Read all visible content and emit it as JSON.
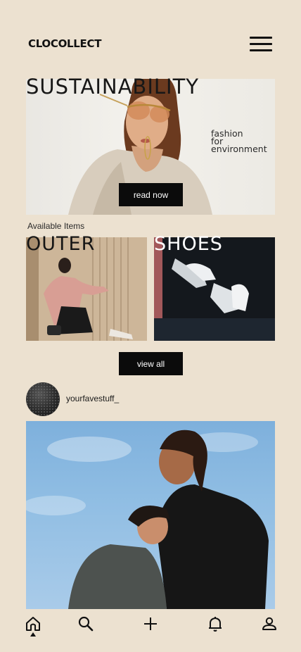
{
  "header": {
    "brand": "CLOCOLLECT",
    "menu_icon": "hamburger-icon"
  },
  "hero": {
    "title": "SUSTAINABILITY",
    "tagline": [
      "fashion",
      "for",
      "environment"
    ],
    "button_label": "read now"
  },
  "catalog": {
    "section_label": "Available Items",
    "categories": [
      {
        "label": "OUTER"
      },
      {
        "label": "SHOES"
      }
    ],
    "view_all_label": "view all"
  },
  "post": {
    "username": "yourfavestuff_"
  },
  "bottom_nav": {
    "items": [
      {
        "icon": "home-icon",
        "active": true
      },
      {
        "icon": "search-icon"
      },
      {
        "icon": "plus-icon"
      },
      {
        "icon": "bell-icon"
      },
      {
        "icon": "user-icon"
      }
    ]
  },
  "colors": {
    "background": "#ece1d0",
    "button": "#0b0b0b",
    "button_text": "#ffffff"
  }
}
